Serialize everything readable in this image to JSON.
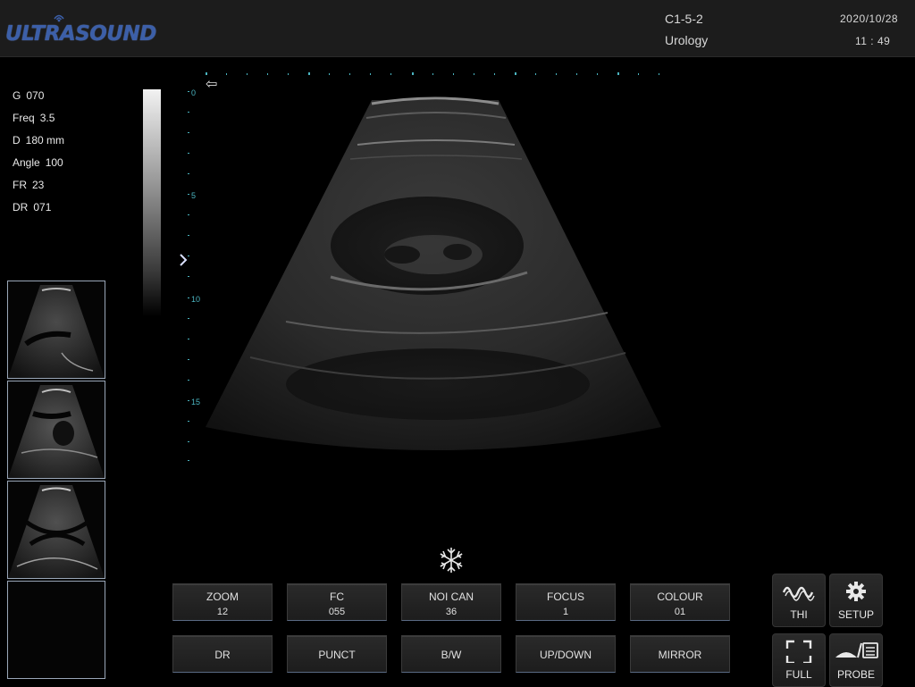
{
  "header": {
    "logo_text": "ULTRASOUND",
    "probe": "C1-5-2",
    "preset": "Urology",
    "date": "2020/10/28",
    "time": "11 : 49"
  },
  "params": [
    {
      "key": "G",
      "value": "070"
    },
    {
      "key": "Freq",
      "value": "3.5"
    },
    {
      "key": "D",
      "value": "180 mm"
    },
    {
      "key": "Angle",
      "value": "100"
    },
    {
      "key": "FR",
      "value": "23"
    },
    {
      "key": "DR",
      "value": "071"
    }
  ],
  "depth_labels": [
    "0",
    "5",
    "10",
    "15"
  ],
  "controls_row1": [
    {
      "label": "ZOOM",
      "value": "12"
    },
    {
      "label": "FC",
      "value": "055"
    },
    {
      "label": "NOI CAN",
      "value": "36"
    },
    {
      "label": "FOCUS",
      "value": "1"
    },
    {
      "label": "COLOUR",
      "value": "01"
    }
  ],
  "controls_row2": [
    "DR",
    "PUNCT",
    "B/W",
    "UP/DOWN",
    "MIRROR"
  ],
  "mode_buttons": {
    "thi": {
      "label": "THI",
      "icon": "wave-icon"
    },
    "setup": {
      "label": "SETUP",
      "icon": "gear-icon"
    },
    "full": {
      "label": "FULL",
      "icon": "fullscreen-icon"
    },
    "probe": {
      "label": "PROBE",
      "icon": "probe-icon"
    }
  },
  "colors": {
    "accent": "#4ab4c0",
    "logo": "#3c5fa8",
    "button_border": "#5a6a84"
  }
}
